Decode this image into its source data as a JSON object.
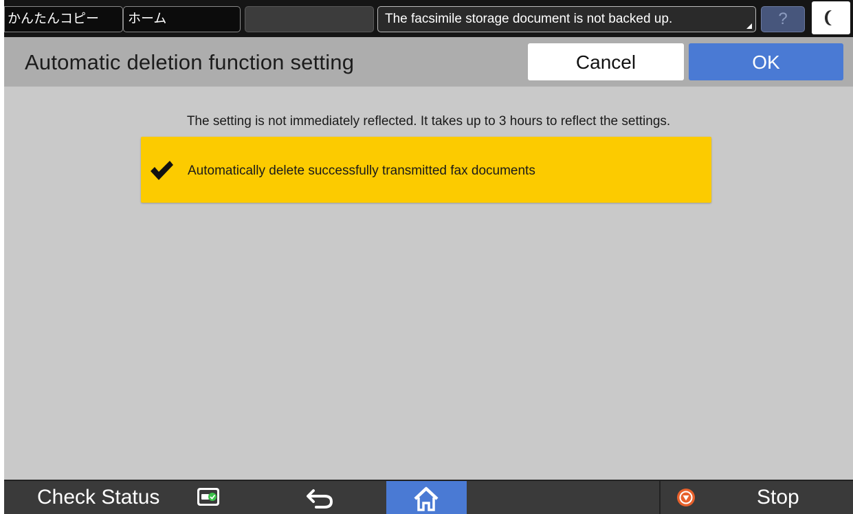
{
  "topbar": {
    "easy_copy_tab": "かんたんコピー",
    "home_tab": "ホーム",
    "message": "The facsimile storage document is not backed up.",
    "help_label": "?"
  },
  "header": {
    "title": "Automatic deletion function setting",
    "cancel_label": "Cancel",
    "ok_label": "OK"
  },
  "main": {
    "notice": "The setting is not immediately reflected. It takes up to 3 hours to reflect the settings.",
    "setting": {
      "label": "Automatically delete successfully transmitted fax documents",
      "checked": true
    }
  },
  "bottombar": {
    "check_status_label": "Check Status",
    "stop_label": "Stop"
  },
  "colors": {
    "accent_blue": "#4a7ad4",
    "highlight_yellow": "#fccb00",
    "stop_orange": "#e8612c",
    "status_green": "#3cc24a"
  },
  "icons": [
    "moon-icon",
    "expand-corner-icon",
    "checkmark-icon",
    "status-monitor-icon",
    "back-arrow-icon",
    "home-icon",
    "stop-icon"
  ]
}
